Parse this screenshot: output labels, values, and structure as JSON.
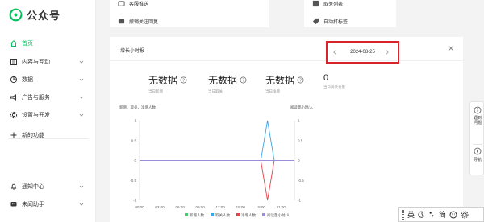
{
  "app": {
    "name": "公众号",
    "brand_color": "#07c160"
  },
  "sidebar": {
    "items": [
      {
        "label": "首页",
        "icon": "home-icon",
        "active": true,
        "expandable": false
      },
      {
        "label": "内容与互动",
        "icon": "content-icon",
        "active": false,
        "expandable": true
      },
      {
        "label": "数据",
        "icon": "data-icon",
        "active": false,
        "expandable": true
      },
      {
        "label": "广告与服务",
        "icon": "ads-icon",
        "active": false,
        "expandable": true
      },
      {
        "label": "设置与开发",
        "icon": "settings-icon",
        "active": false,
        "expandable": true
      },
      {
        "label": "新的功能",
        "icon": "plus-icon",
        "active": false,
        "expandable": false
      }
    ],
    "bottom_items": [
      {
        "label": "通知中心",
        "icon": "bell-icon",
        "expandable": true
      },
      {
        "label": "未闻助手",
        "icon": "assistant-icon",
        "expandable": true
      }
    ]
  },
  "top_cards": {
    "left": [
      {
        "label": "客服推送",
        "icon": "message-icon"
      },
      {
        "label": "撤销关注回复",
        "icon": "chat-icon"
      }
    ],
    "right": [
      {
        "label": "取关列表",
        "icon": "list-icon"
      },
      {
        "label": "自动打标签",
        "icon": "tag-icon"
      }
    ]
  },
  "panel": {
    "title": "增长小时报",
    "date": "2024-08-25",
    "stats": [
      {
        "value": "无数据",
        "label": "当日新增"
      },
      {
        "value": "无数据",
        "label": "当日取关"
      },
      {
        "value": "无数据",
        "label": "当日净增"
      },
      {
        "value": "0",
        "label": "当日阅读总量"
      }
    ]
  },
  "chart_data": {
    "type": "line",
    "title": "",
    "left_axis_label": "新增、取关、净增人数",
    "right_axis_label": "阅读量小时/人",
    "x": [
      "00:00",
      "03:00",
      "06:00",
      "09:00",
      "12:00",
      "15:00",
      "18:00",
      "21:00"
    ],
    "ylim_left": [
      -1,
      1
    ],
    "ylim_right": [
      -1,
      1
    ],
    "y_ticks_left": [
      "1",
      "0.5",
      "0",
      "-0.5",
      "-1"
    ],
    "y_ticks_right": [
      "1",
      "0.5",
      "0",
      "-0.5",
      "-1"
    ],
    "series": [
      {
        "name": "新增人数",
        "color": "#4dc878",
        "hours": [
          0,
          1,
          2,
          3,
          4,
          5,
          6,
          7,
          8,
          9,
          10,
          11,
          12,
          13,
          14,
          15,
          16,
          17,
          18,
          19,
          20,
          21,
          22,
          23
        ],
        "values": [
          0,
          0,
          0,
          0,
          0,
          0,
          0,
          0,
          0,
          0,
          0,
          0,
          0,
          0,
          0,
          0,
          0,
          0,
          0,
          0,
          0,
          0,
          0,
          0
        ]
      },
      {
        "name": "取关人数",
        "color": "#3aa7e2",
        "hours": [
          0,
          1,
          2,
          3,
          4,
          5,
          6,
          7,
          8,
          9,
          10,
          11,
          12,
          13,
          14,
          15,
          16,
          17,
          18,
          19,
          20,
          21,
          22,
          23
        ],
        "values": [
          0,
          0,
          0,
          0,
          0,
          0,
          0,
          0,
          0,
          0,
          0,
          0,
          0,
          0,
          0,
          0,
          0,
          0,
          0,
          1,
          0,
          0,
          0,
          0
        ]
      },
      {
        "name": "净增人数",
        "color": "#e4434b",
        "hours": [
          0,
          1,
          2,
          3,
          4,
          5,
          6,
          7,
          8,
          9,
          10,
          11,
          12,
          13,
          14,
          15,
          16,
          17,
          18,
          19,
          20,
          21,
          22,
          23
        ],
        "values": [
          0,
          0,
          0,
          0,
          0,
          0,
          0,
          0,
          0,
          0,
          0,
          0,
          0,
          0,
          0,
          0,
          0,
          0,
          0,
          -1,
          0,
          0,
          0,
          0
        ]
      },
      {
        "name": "阅读量小时/人",
        "color": "#9a8cd6",
        "hours": [
          0,
          1,
          2,
          3,
          4,
          5,
          6,
          7,
          8,
          9,
          10,
          11,
          12,
          13,
          14,
          15,
          16,
          17,
          18,
          19,
          20,
          21,
          22,
          23
        ],
        "values": [
          0,
          0,
          0,
          0,
          0,
          0,
          0,
          0,
          0,
          0,
          0,
          0,
          0,
          0,
          0,
          0,
          0,
          0,
          0,
          0,
          0,
          0,
          0,
          0
        ]
      }
    ],
    "legend_position": "bottom",
    "grid": false
  },
  "right_rail": [
    {
      "label": "遇到问题",
      "icon": "help-icon"
    },
    {
      "label": "导航",
      "icon": "compass-icon"
    }
  ],
  "ime": {
    "items": [
      "英",
      "简"
    ]
  }
}
